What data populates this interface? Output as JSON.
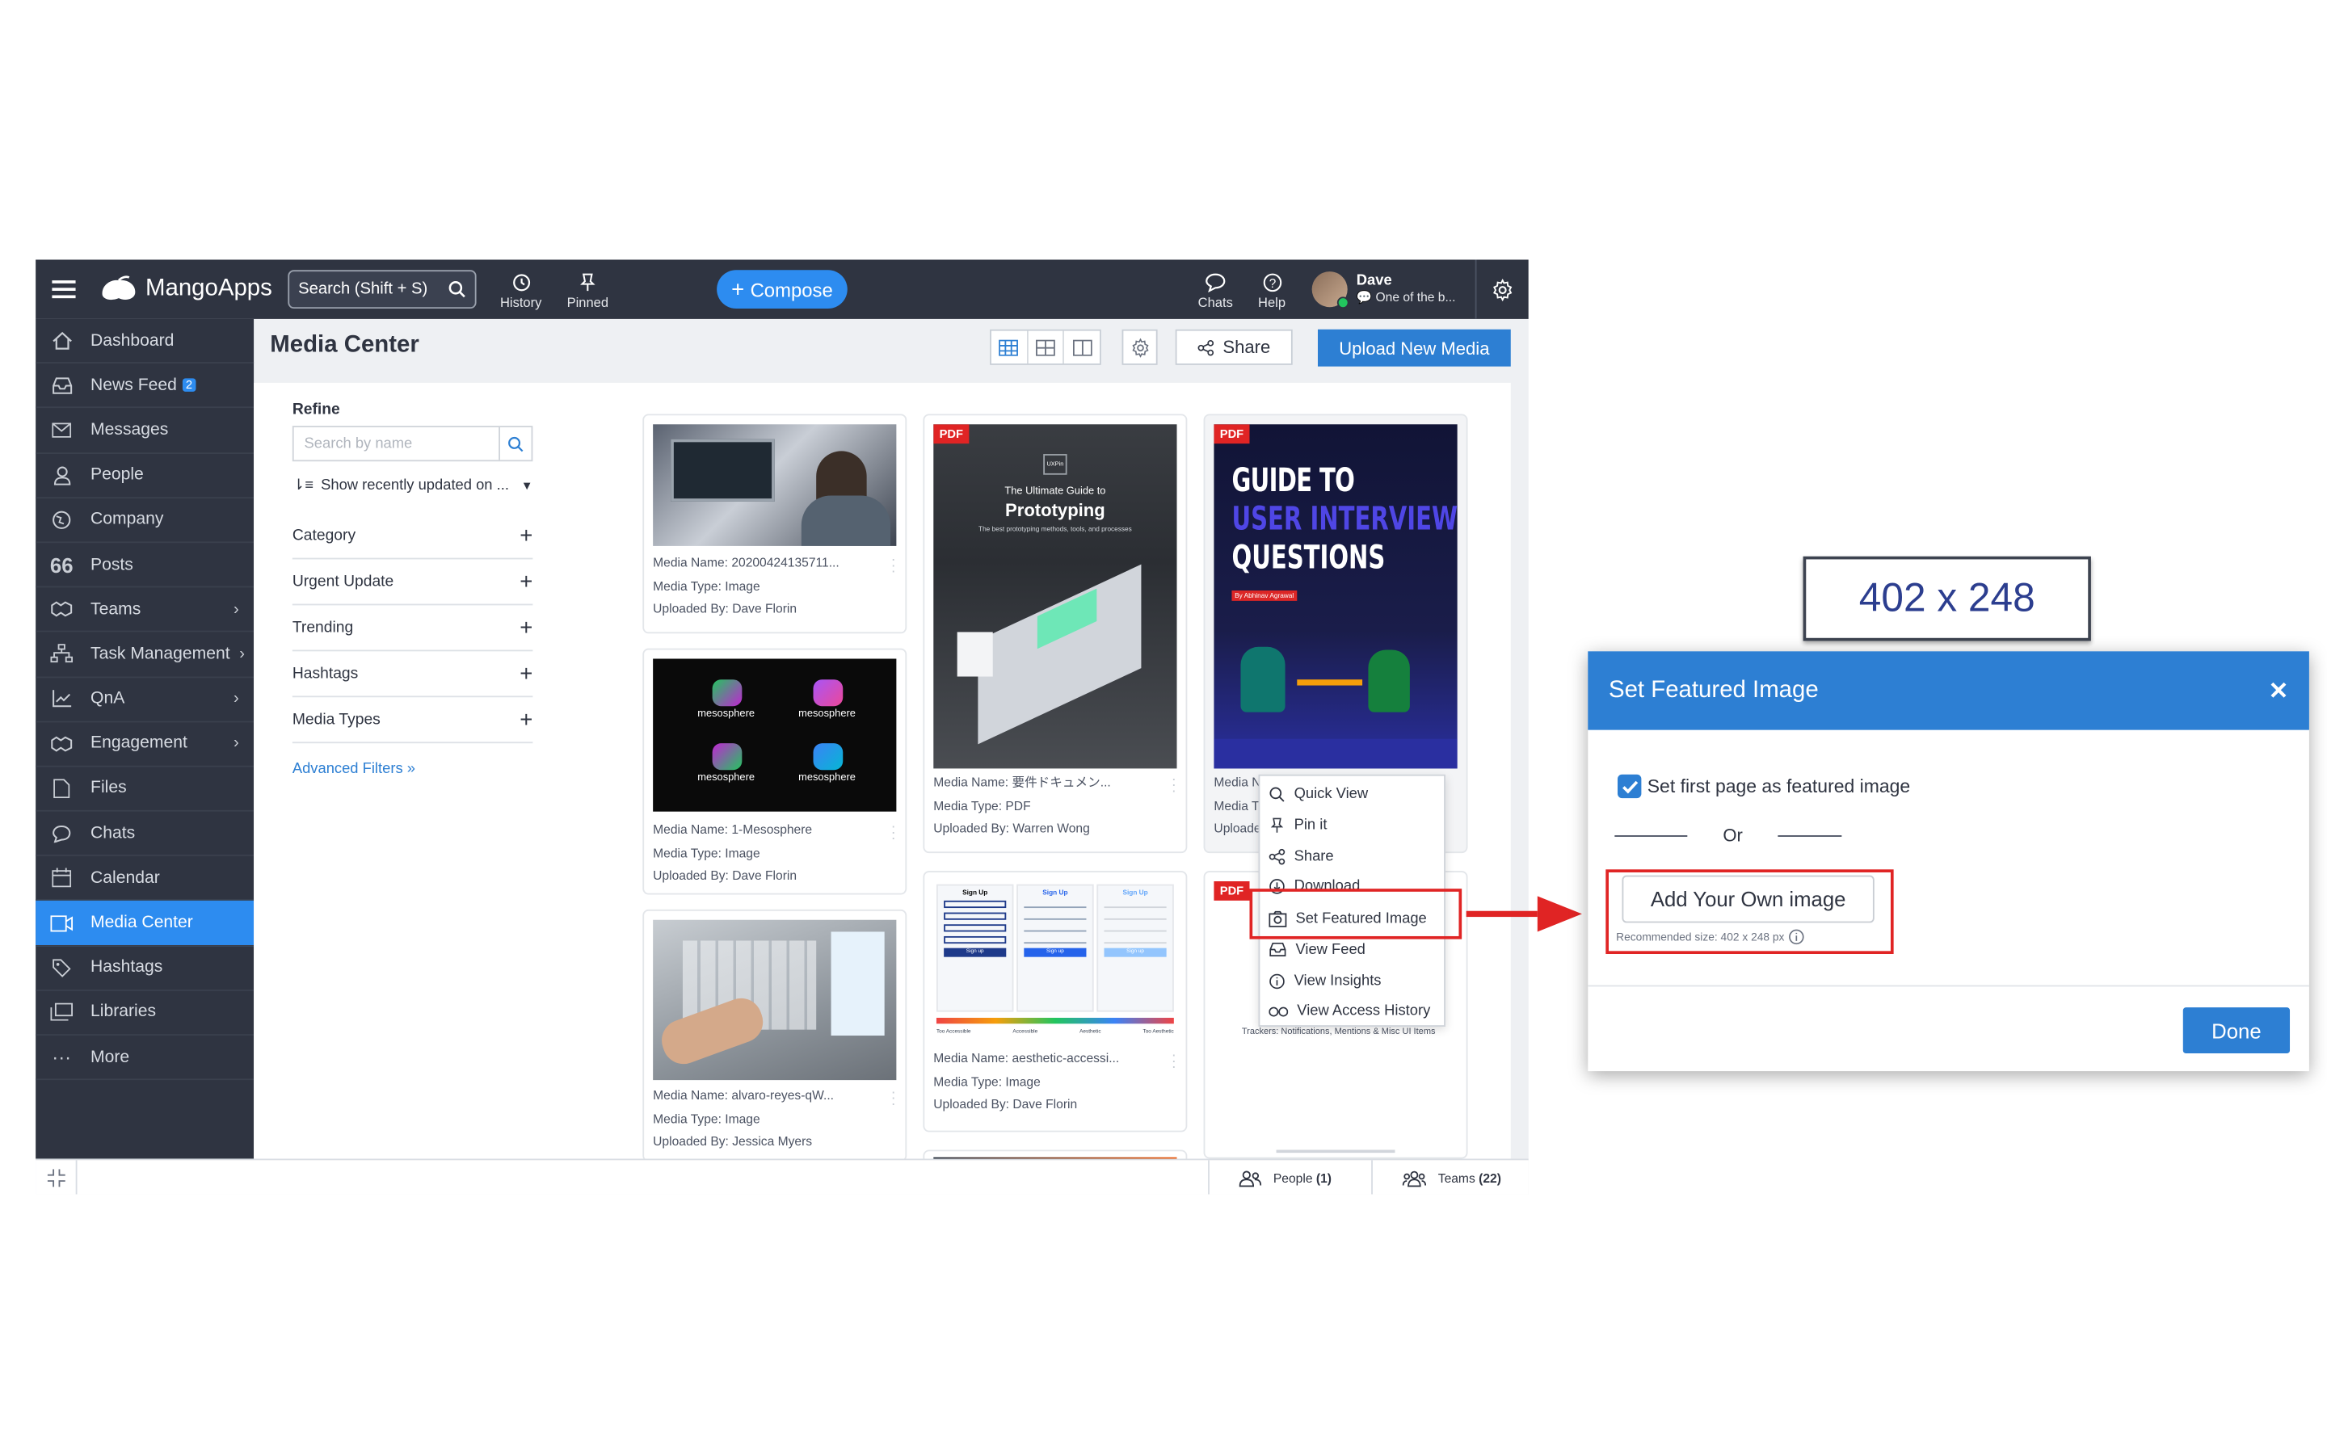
{
  "app": {
    "name": "MangoApps",
    "search_placeholder": "Search (Shift + S)",
    "toolbar": {
      "history": "History",
      "pinned": "Pinned",
      "compose": "Compose",
      "chats": "Chats",
      "help": "Help"
    },
    "user": {
      "name": "Dave",
      "status": "One of the b..."
    }
  },
  "sidebar": {
    "items": [
      {
        "label": "Dashboard",
        "icon": "home-icon"
      },
      {
        "label": "News Feed",
        "icon": "inbox-icon",
        "badge": "2"
      },
      {
        "label": "Messages",
        "icon": "mail-icon"
      },
      {
        "label": "People",
        "icon": "person-icon"
      },
      {
        "label": "Company",
        "icon": "globe-icon"
      },
      {
        "label": "Posts",
        "icon": "quote-icon"
      },
      {
        "label": "Teams",
        "icon": "handshake-icon",
        "chevron": true
      },
      {
        "label": "Task Management",
        "icon": "hierarchy-icon",
        "chevron": true
      },
      {
        "label": "QnA",
        "icon": "chart-icon",
        "chevron": true
      },
      {
        "label": "Engagement",
        "icon": "handshake-icon",
        "chevron": true
      },
      {
        "label": "Files",
        "icon": "file-icon"
      },
      {
        "label": "Chats",
        "icon": "chat-icon"
      },
      {
        "label": "Calendar",
        "icon": "calendar-icon"
      },
      {
        "label": "Media Center",
        "icon": "video-icon",
        "active": true
      },
      {
        "label": "Hashtags",
        "icon": "tag-icon"
      },
      {
        "label": "Libraries",
        "icon": "library-icon"
      },
      {
        "label": "More",
        "icon": "more-icon"
      }
    ]
  },
  "main": {
    "title": "Media Center",
    "share": "Share",
    "upload": "Upload New Media"
  },
  "refine": {
    "title": "Refine",
    "search_placeholder": "Search by name",
    "sort": "Show recently updated on ...",
    "filters": [
      "Category",
      "Urgent Update",
      "Trending",
      "Hashtags",
      "Media Types"
    ],
    "advanced": "Advanced Filters"
  },
  "cards": [
    {
      "name": "Media Name: 20200424135711...",
      "type": "Media Type: Image",
      "by": "Uploaded By: Dave Florin"
    },
    {
      "name": "Media Name: 1-Mesosphere",
      "type": "Media Type: Image",
      "by": "Uploaded By: Dave Florin",
      "thumb_text": "mesosphere"
    },
    {
      "name": "Media Name: alvaro-reyes-qW...",
      "type": "Media Type: Image",
      "by": "Uploaded By: Jessica Myers"
    },
    {
      "name": "Media Name: 要件ドキュメン...",
      "type": "Media Type: PDF",
      "by": "Uploaded By: Warren Wong",
      "pdf": "PDF",
      "thumb_title1": "The Ultimate Guide to",
      "thumb_title2": "Prototyping",
      "thumb_sub": "The best prototyping methods, tools, and processes",
      "thumb_logo": "UXPin"
    },
    {
      "name": "Media Name: aesthetic-accessi...",
      "type": "Media Type: Image",
      "by": "Uploaded By: Dave Florin",
      "thumb_h": "Sign Up",
      "thumb_btn": "Sign up",
      "thumb_foot1": "Too Accessible",
      "thumb_foot2": "Accessible",
      "thumb_foot3": "Aesthetic",
      "thumb_foot4": "Too Aesthetic"
    },
    {
      "name": "Media Name:",
      "type": "Media Type: P",
      "by": "Uploaded By:",
      "pdf": "PDF",
      "thumb_l1": "GUIDE TO",
      "thumb_l2": "USER INTERVIEW",
      "thumb_l3": "QUESTIONS",
      "thumb_author": "By Abhinav Agrawal"
    },
    {
      "pdf": "PDF",
      "caption": "Trackers: Notifications, Mentions & Misc UI Items"
    }
  ],
  "context_menu": {
    "items": [
      "Quick View",
      "Pin it",
      "Share",
      "Download",
      "Set Featured Image",
      "View Feed",
      "View Insights",
      "View Access History"
    ]
  },
  "statusbar": {
    "people": "People",
    "people_count": "(1)",
    "teams": "Teams",
    "teams_count": "(22)"
  },
  "size_label": "402 x 248",
  "modal": {
    "title": "Set Featured Image",
    "checkbox_label": "Set first page as featured image",
    "checkbox_checked": true,
    "or": "Or",
    "add_own": "Add Your Own image",
    "recommended": "Recommended size: 402 x 248 px",
    "done": "Done"
  },
  "colors": {
    "topbar": "#2f3441",
    "accent": "#2d7fd3",
    "highlight": "#e02424"
  }
}
